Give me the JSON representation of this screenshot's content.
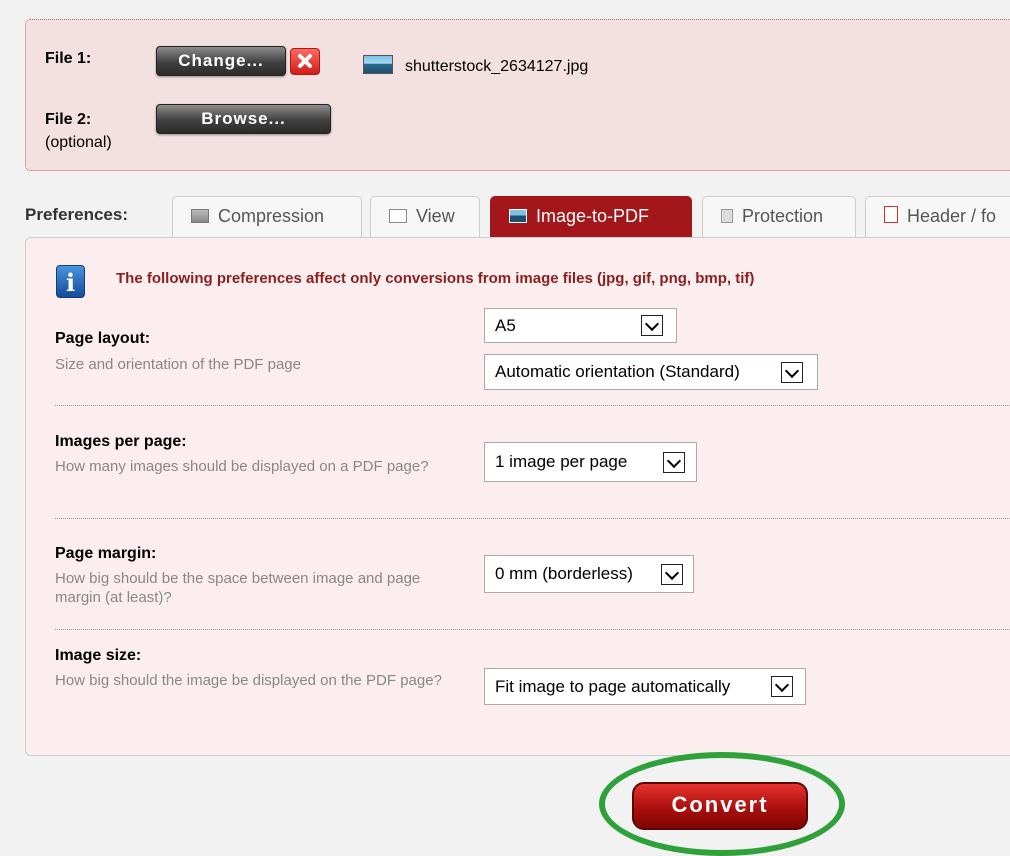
{
  "files": {
    "file1_label": "File 1:",
    "change_button": "Change...",
    "file1_name": "shutterstock_2634127.jpg",
    "file2_label": "File 2:",
    "file2_sub": "(optional)",
    "browse_button": "Browse..."
  },
  "preferences": {
    "label": "Preferences:",
    "tabs": [
      {
        "label": "Compression",
        "icon": "compression-icon"
      },
      {
        "label": "View",
        "icon": "magnifier-icon"
      },
      {
        "label": "Image-to-PDF",
        "icon": "image-icon",
        "active": true
      },
      {
        "label": "Protection",
        "icon": "lock-icon"
      },
      {
        "label": "Header / fo",
        "icon": "document-icon"
      }
    ]
  },
  "panel": {
    "info": "The following preferences affect only conversions from image files (jpg, gif, png, bmp, tif)",
    "rows": [
      {
        "title": "Page layout:",
        "desc": "Size and orientation of the PDF page",
        "selects": [
          "A5",
          "Automatic orientation (Standard)"
        ]
      },
      {
        "title": "Images per page:",
        "desc": "How many images should be displayed on a PDF page?",
        "selects": [
          "1 image per page"
        ]
      },
      {
        "title": "Page margin:",
        "desc": "How big should be the space between image and page margin (at least)?",
        "selects": [
          "0 mm (borderless)"
        ]
      },
      {
        "title": "Image size:",
        "desc": "How big should the image be displayed on the PDF page?",
        "selects": [
          "Fit image to page automatically"
        ]
      }
    ]
  },
  "convert_button": "Convert",
  "colors": {
    "accent": "#a3161a",
    "panel_bg": "#fceeee",
    "highlight": "#2ea13a"
  }
}
